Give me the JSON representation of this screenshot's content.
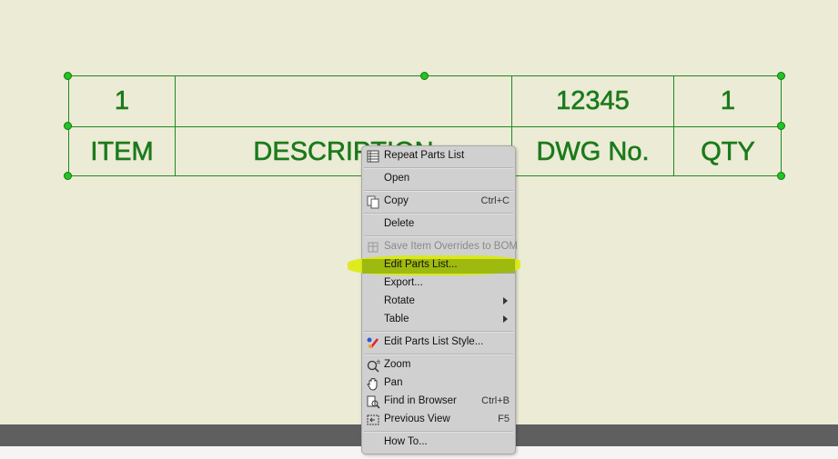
{
  "parts_list": {
    "row1": {
      "item": "1",
      "description": "",
      "dwg_no": "12345",
      "qty": "1"
    },
    "header": {
      "item": "ITEM",
      "description": "DESCRIPTION",
      "dwg_no": "DWG No.",
      "qty": "QTY"
    }
  },
  "context_menu": {
    "repeat_parts_list": "Repeat Parts List",
    "open": "Open",
    "copy": "Copy",
    "copy_shortcut": "Ctrl+C",
    "delete": "Delete",
    "save_item_overrides": "Save Item Overrides to BOM",
    "edit_parts_list": "Edit Parts List...",
    "export": "Export...",
    "rotate": "Rotate",
    "table": "Table",
    "edit_parts_list_style": "Edit Parts List Style...",
    "zoom": "Zoom",
    "pan": "Pan",
    "find_in_browser": "Find in Browser",
    "find_in_browser_shortcut": "Ctrl+B",
    "previous_view": "Previous View",
    "previous_view_shortcut": "F5",
    "how_to": "How To..."
  },
  "colors": {
    "table_green": "#1a7a1a",
    "grip_green": "#22c322",
    "highlight": "#dceb00",
    "background": "#ecebd6"
  }
}
